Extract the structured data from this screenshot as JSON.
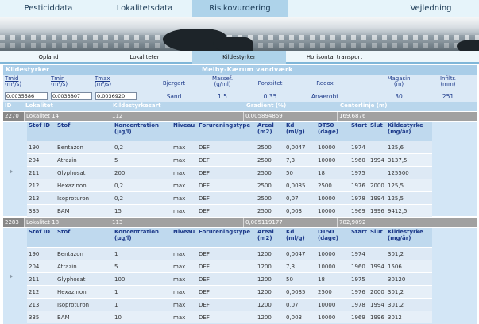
{
  "topnav": {
    "tabs": [
      {
        "label": "Pesticiddata"
      },
      {
        "label": "Lokalitetsdata"
      },
      {
        "label": "Risikovurdering",
        "active": true
      },
      {
        "label": "Vejledning"
      }
    ]
  },
  "subnav": {
    "tabs": [
      {
        "label": "Opland"
      },
      {
        "label": "Lokaliteter"
      },
      {
        "label": "Kildestyrker",
        "active": true
      },
      {
        "label": "Horisontal transport"
      }
    ]
  },
  "section": {
    "title": "Kildestyrker",
    "site_name": "Melby-Kærum vandværk"
  },
  "params": {
    "tmid_label": "Tmid (m³/s)",
    "tmin_label": "Tmin (m³/s)",
    "tmax_label": "Tmax (m³/s)",
    "tmid_value": "0,0035586",
    "tmin_value": "0,0033807",
    "tmax_value": "0,0036920",
    "bjergart_label": "Bjergart",
    "bjergart_value": "Sand",
    "massef_label": "Massef. (g/ml)",
    "massef_value": "1.5",
    "porositet_label": "Porøsitet",
    "porositet_value": "0.35",
    "redox_label": "Redox",
    "redox_value": "Anaerobt",
    "magasin_label": "Magasin (m)",
    "magasin_value": "30",
    "infiltr_label": "Infiltr. (mm)",
    "infiltr_value": "251"
  },
  "loc_header": {
    "id": "ID",
    "lokalitet": "Lokalitet",
    "kildestyrkesart": "Kildestyrkesart",
    "gradient": "Gradient (%)",
    "centerlinje": "Centerlinje (m)"
  },
  "stof_header": {
    "stof_id": "Stof ID",
    "stof": "Stof",
    "koncentration": "Koncentration (µg/l)",
    "niveau": "Niveau",
    "forureningstype": "Forureningstype",
    "areal": "Areal (m2)",
    "kd": "Kd (ml/g)",
    "dt50": "DT50 (dage)",
    "start": "Start",
    "slut": "Slut",
    "kildestyrke": "Kildestyrke (mg/år)"
  },
  "locations": [
    {
      "id": "2270",
      "lokalitet": "Lokalitet 14",
      "kildestyrkesart": "112",
      "gradient": "0,005894859",
      "centerlinje": "169,6876",
      "rows": [
        {
          "stof_id": "190",
          "stof": "Bentazon",
          "konc": "0,2",
          "niveau": "max",
          "type": "DEF",
          "areal": "2500",
          "kd": "0,0047",
          "dt50": "10000",
          "start": "1974",
          "slut": "",
          "kildestyrke": "125,6"
        },
        {
          "stof_id": "204",
          "stof": "Atrazin",
          "konc": "5",
          "niveau": "max",
          "type": "DEF",
          "areal": "2500",
          "kd": "7,3",
          "dt50": "10000",
          "start": "1960",
          "slut": "1994",
          "kildestyrke": "3137,5"
        },
        {
          "stof_id": "211",
          "stof": "Glyphosat",
          "konc": "200",
          "niveau": "max",
          "type": "DEF",
          "areal": "2500",
          "kd": "50",
          "dt50": "18",
          "start": "1975",
          "slut": "",
          "kildestyrke": "125500"
        },
        {
          "stof_id": "212",
          "stof": "Hexazinon",
          "konc": "0,2",
          "niveau": "max",
          "type": "DEF",
          "areal": "2500",
          "kd": "0,0035",
          "dt50": "2500",
          "start": "1976",
          "slut": "2000",
          "kildestyrke": "125,5"
        },
        {
          "stof_id": "213",
          "stof": "Isoproturon",
          "konc": "0,2",
          "niveau": "max",
          "type": "DEF",
          "areal": "2500",
          "kd": "0,07",
          "dt50": "10000",
          "start": "1978",
          "slut": "1994",
          "kildestyrke": "125,5"
        },
        {
          "stof_id": "335",
          "stof": "BAM",
          "konc": "15",
          "niveau": "max",
          "type": "DEF",
          "areal": "2500",
          "kd": "0,003",
          "dt50": "10000",
          "start": "1969",
          "slut": "1996",
          "kildestyrke": "9412,5"
        }
      ]
    },
    {
      "id": "2283",
      "lokalitet": "Lokalitet 18",
      "kildestyrkesart": "113",
      "gradient": "0,005119177",
      "centerlinje": "782,9092",
      "rows": [
        {
          "stof_id": "190",
          "stof": "Bentazon",
          "konc": "1",
          "niveau": "max",
          "type": "DEF",
          "areal": "1200",
          "kd": "0,0047",
          "dt50": "10000",
          "start": "1974",
          "slut": "",
          "kildestyrke": "301,2"
        },
        {
          "stof_id": "204",
          "stof": "Atrazin",
          "konc": "5",
          "niveau": "max",
          "type": "DEF",
          "areal": "1200",
          "kd": "7,3",
          "dt50": "10000",
          "start": "1960",
          "slut": "1994",
          "kildestyrke": "1506"
        },
        {
          "stof_id": "211",
          "stof": "Glyphosat",
          "konc": "100",
          "niveau": "max",
          "type": "DEF",
          "areal": "1200",
          "kd": "50",
          "dt50": "18",
          "start": "1975",
          "slut": "",
          "kildestyrke": "30120"
        },
        {
          "stof_id": "212",
          "stof": "Hexazinon",
          "konc": "1",
          "niveau": "max",
          "type": "DEF",
          "areal": "1200",
          "kd": "0,0035",
          "dt50": "2500",
          "start": "1976",
          "slut": "2000",
          "kildestyrke": "301,2"
        },
        {
          "stof_id": "213",
          "stof": "Isoproturon",
          "konc": "1",
          "niveau": "max",
          "type": "DEF",
          "areal": "1200",
          "kd": "0,07",
          "dt50": "10000",
          "start": "1978",
          "slut": "1994",
          "kildestyrke": "301,2"
        },
        {
          "stof_id": "335",
          "stof": "BAM",
          "konc": "10",
          "niveau": "max",
          "type": "DEF",
          "areal": "1200",
          "kd": "0,003",
          "dt50": "10000",
          "start": "1969",
          "slut": "1996",
          "kildestyrke": "3012"
        }
      ]
    }
  ]
}
